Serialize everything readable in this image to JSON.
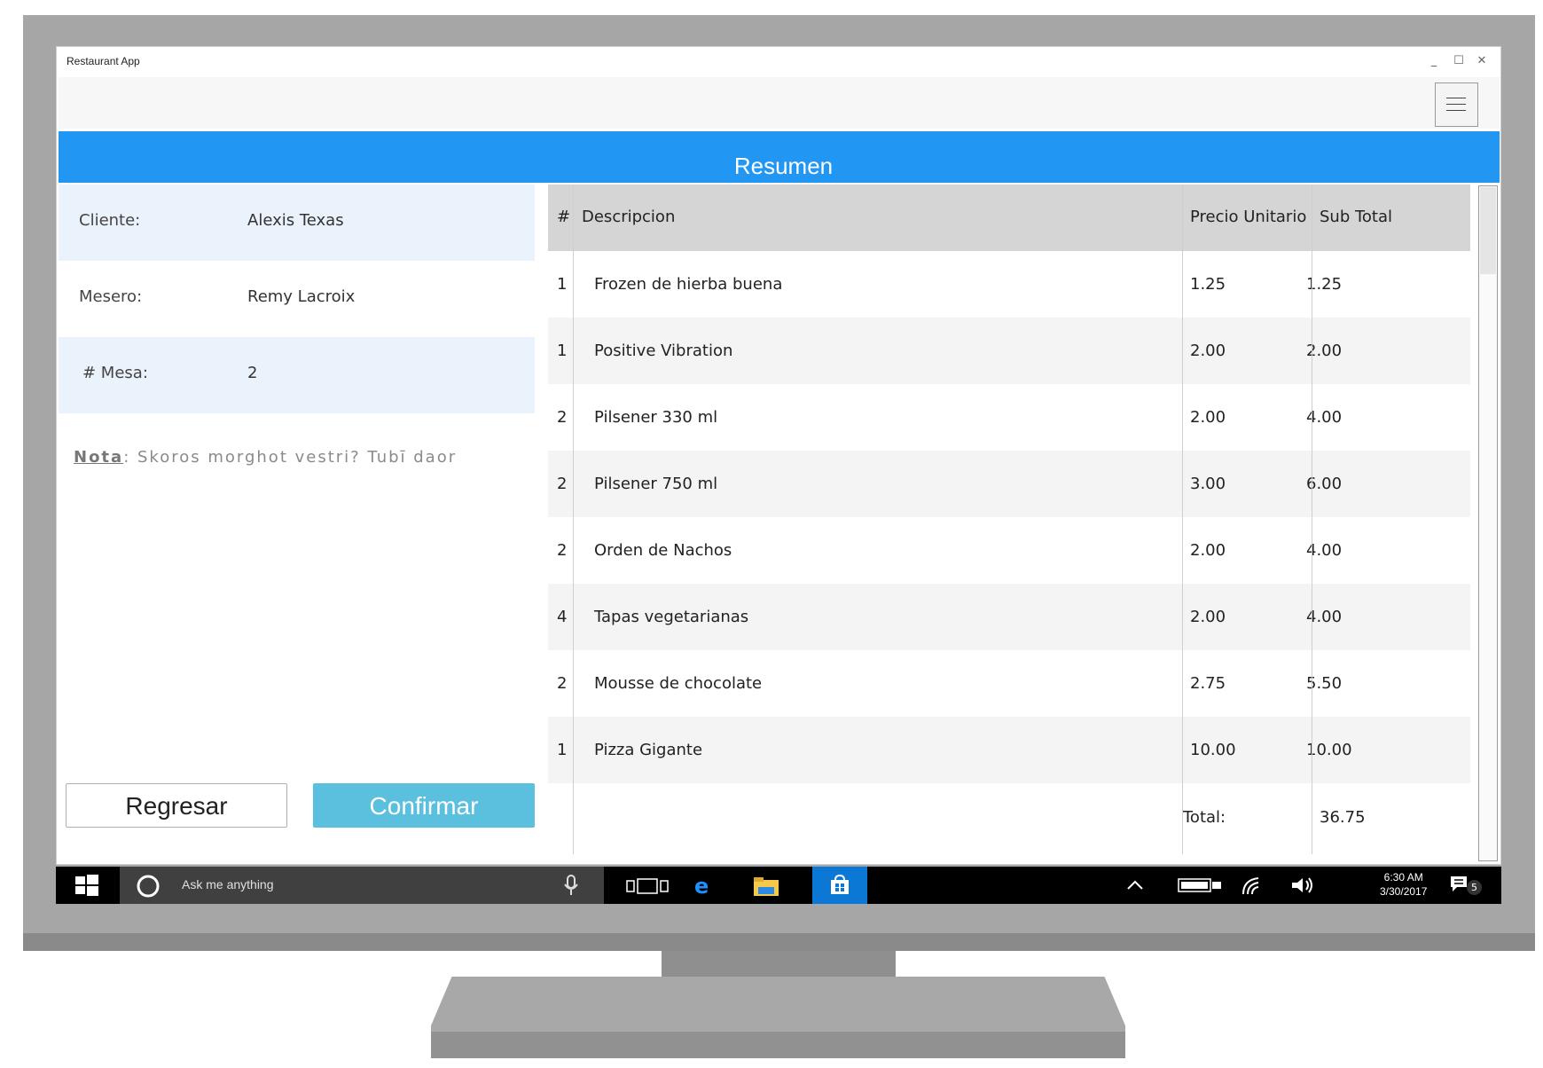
{
  "window": {
    "title": "Restaurant App",
    "minimize": "_",
    "maximize": "☐",
    "close": "✕"
  },
  "header": {
    "title": "Resumen"
  },
  "info": [
    {
      "label": "Cliente:",
      "value": "Alexis Texas"
    },
    {
      "label": "Mesero:",
      "value": "Remy Lacroix"
    },
    {
      "label": "# Mesa:",
      "value": "2"
    }
  ],
  "nota": {
    "label": "Nota",
    "separator": ":",
    "text": "Skoros morghot vestri? Tubī daor"
  },
  "buttons": {
    "back": "Regresar",
    "confirm": "Confirmar"
  },
  "table": {
    "headers": {
      "qty": "#",
      "desc": "Descripcion",
      "price": "Precio Unitario",
      "subtotal": "Sub Total"
    },
    "rows": [
      {
        "qty": "1",
        "desc": "Frozen de hierba buena",
        "price": "1.25",
        "subtotal": "1.25"
      },
      {
        "qty": "1",
        "desc": "Positive Vibration",
        "price": "2.00",
        "subtotal": "2.00"
      },
      {
        "qty": "2",
        "desc": "Pilsener 330 ml",
        "price": "2.00",
        "subtotal": "4.00"
      },
      {
        "qty": "2",
        "desc": "Pilsener 750 ml",
        "price": "3.00",
        "subtotal": "6.00"
      },
      {
        "qty": "2",
        "desc": "Orden de Nachos",
        "price": "2.00",
        "subtotal": "4.00"
      },
      {
        "qty": "4",
        "desc": "Tapas vegetarianas",
        "price": "2.00",
        "subtotal": "4.00"
      },
      {
        "qty": "2",
        "desc": "Mousse de chocolate",
        "price": "2.75",
        "subtotal": "5.50"
      },
      {
        "qty": "1",
        "desc": "Pizza Gigante",
        "price": "10.00",
        "subtotal": "10.00"
      }
    ],
    "total_label": "Total:",
    "total_value": "36.75"
  },
  "taskbar": {
    "search_placeholder": "Ask me anything",
    "time": "6:30 AM",
    "date": "3/30/2017",
    "notifications": "5"
  },
  "colors": {
    "header": "#2196f3",
    "confirm": "#5bc0de",
    "info_shade": "#eaf2fc"
  },
  "icons": [
    "windows-logo-icon",
    "cortana-icon",
    "microphone-icon",
    "task-view-icon",
    "edge-icon",
    "file-explorer-icon",
    "store-icon",
    "chevron-up-icon",
    "battery-icon",
    "wifi-icon",
    "volume-icon",
    "action-center-icon",
    "hamburger-menu-icon"
  ]
}
